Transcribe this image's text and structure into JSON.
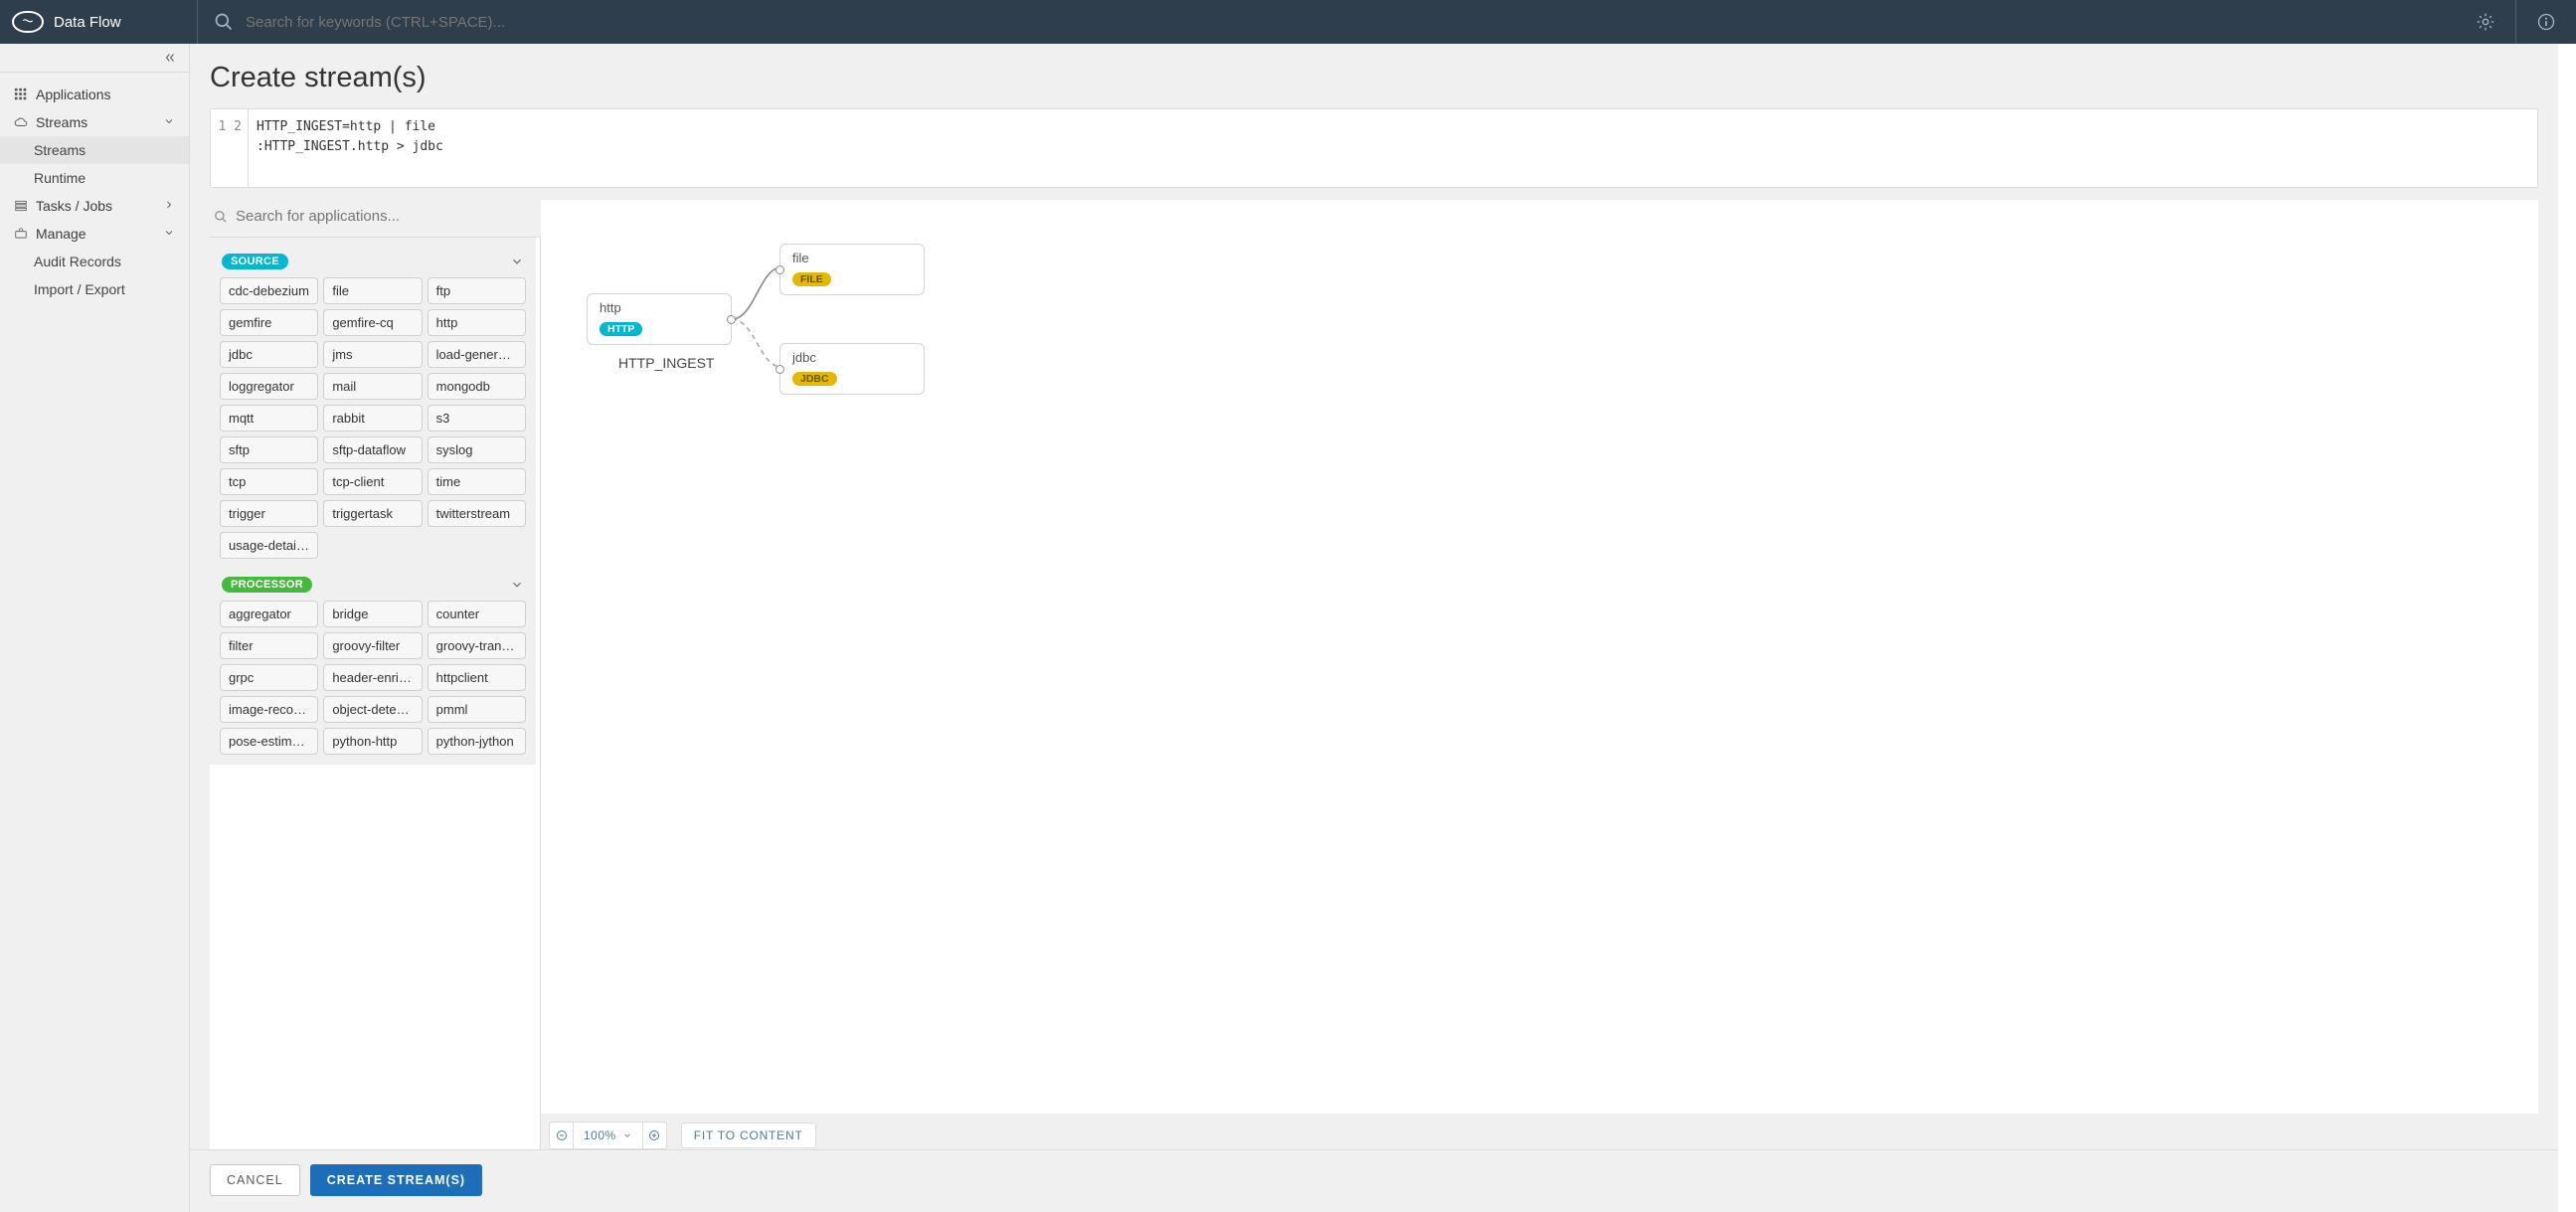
{
  "header": {
    "brand": "Data Flow",
    "search_placeholder": "Search for keywords (CTRL+SPACE)..."
  },
  "sidebar": {
    "items": [
      {
        "label": "Applications",
        "icon": "grid-icon"
      },
      {
        "label": "Streams",
        "icon": "cloud-icon",
        "expanded": true,
        "children": [
          {
            "label": "Streams",
            "active": true
          },
          {
            "label": "Runtime"
          }
        ]
      },
      {
        "label": "Tasks / Jobs",
        "icon": "tasks-icon"
      },
      {
        "label": "Manage",
        "icon": "toolbox-icon",
        "expanded": true,
        "children": [
          {
            "label": "Audit Records"
          },
          {
            "label": "Import / Export"
          }
        ]
      }
    ]
  },
  "page": {
    "title": "Create stream(s)",
    "code": {
      "lines": [
        "HTTP_INGEST=http | file",
        ":HTTP_INGEST.http > jdbc"
      ]
    },
    "palette_search_placeholder": "Search for applications...",
    "palette": {
      "source": {
        "label": "SOURCE",
        "items": [
          "cdc-debezium",
          "file",
          "ftp",
          "gemfire",
          "gemfire-cq",
          "http",
          "jdbc",
          "jms",
          "load-generator",
          "loggregator",
          "mail",
          "mongodb",
          "mqtt",
          "rabbit",
          "s3",
          "sftp",
          "sftp-dataflow",
          "syslog",
          "tcp",
          "tcp-client",
          "time",
          "trigger",
          "triggertask",
          "twitterstream",
          "usage-detail-se..."
        ]
      },
      "processor": {
        "label": "PROCESSOR",
        "items": [
          "aggregator",
          "bridge",
          "counter",
          "filter",
          "groovy-filter",
          "groovy-transform",
          "grpc",
          "header-enricher",
          "httpclient",
          "image-recogniti...",
          "object-detection",
          "pmml",
          "pose-estimation",
          "python-http",
          "python-jython"
        ]
      }
    },
    "canvas": {
      "stream_label": "HTTP_INGEST",
      "nodes": {
        "http": {
          "title": "http",
          "tag": "HTTP"
        },
        "file": {
          "title": "file",
          "tag": "FILE"
        },
        "jdbc": {
          "title": "jdbc",
          "tag": "JDBC"
        }
      },
      "zoom": "100%",
      "fit_label": "FIT TO CONTENT"
    },
    "footer": {
      "cancel": "CANCEL",
      "create": "CREATE STREAM(S)"
    }
  }
}
